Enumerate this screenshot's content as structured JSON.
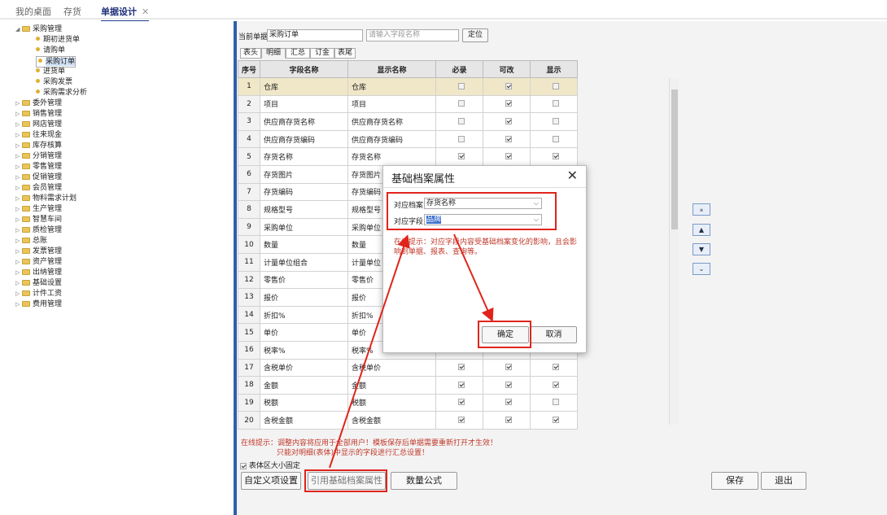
{
  "topbar": {
    "tabs": [
      {
        "label": "我的桌面"
      },
      {
        "label": "存货"
      },
      {
        "label": "单据设计",
        "close": "✕"
      }
    ]
  },
  "tree": {
    "nodes": [
      {
        "label": "采购管理",
        "type": "folder",
        "expanded": true
      },
      {
        "label": "期初进货单",
        "type": "leaf"
      },
      {
        "label": "请购单",
        "type": "leaf"
      },
      {
        "label": "采购订单",
        "type": "leaf",
        "selected": true
      },
      {
        "label": "进货单",
        "type": "leaf"
      },
      {
        "label": "采购发票",
        "type": "leaf"
      },
      {
        "label": "采购需求分析",
        "type": "leaf"
      },
      {
        "label": "委外管理",
        "type": "folder"
      },
      {
        "label": "销售管理",
        "type": "folder"
      },
      {
        "label": "网店管理",
        "type": "folder"
      },
      {
        "label": "往来现金",
        "type": "folder"
      },
      {
        "label": "库存核算",
        "type": "folder"
      },
      {
        "label": "分销管理",
        "type": "folder"
      },
      {
        "label": "零售管理",
        "type": "folder"
      },
      {
        "label": "促销管理",
        "type": "folder"
      },
      {
        "label": "会员管理",
        "type": "folder"
      },
      {
        "label": "物料需求计划",
        "type": "folder"
      },
      {
        "label": "生产管理",
        "type": "folder"
      },
      {
        "label": "智慧车间",
        "type": "folder"
      },
      {
        "label": "质检管理",
        "type": "folder"
      },
      {
        "label": "总账",
        "type": "folder"
      },
      {
        "label": "发票管理",
        "type": "folder"
      },
      {
        "label": "资产管理",
        "type": "folder"
      },
      {
        "label": "出纳管理",
        "type": "folder"
      },
      {
        "label": "基础设置",
        "type": "folder"
      },
      {
        "label": "计件工资",
        "type": "folder"
      },
      {
        "label": "费用管理",
        "type": "folder"
      }
    ]
  },
  "main": {
    "current_doc_label": "当前单据",
    "current_doc_value": "采购订单",
    "field_search_placeholder": "请输入字段名称",
    "locate_button": "定位",
    "subtabs": [
      {
        "label": "表头"
      },
      {
        "label": "明细"
      },
      {
        "label": "汇总"
      },
      {
        "label": "订金"
      },
      {
        "label": "表尾"
      }
    ],
    "columns": [
      "序号",
      "字段名称",
      "显示名称",
      "必录",
      "可改",
      "显示"
    ],
    "rows": [
      {
        "n": "1",
        "field": "仓库",
        "display": "仓库",
        "req": false,
        "edit": true,
        "show": false,
        "highlight": true
      },
      {
        "n": "2",
        "field": "项目",
        "display": "项目",
        "req": false,
        "edit": true,
        "show": false
      },
      {
        "n": "3",
        "field": "供应商存货名称",
        "display": "供应商存货名称",
        "req": false,
        "edit": true,
        "show": false
      },
      {
        "n": "4",
        "field": "供应商存货编码",
        "display": "供应商存货编码",
        "req": false,
        "edit": true,
        "show": false
      },
      {
        "n": "5",
        "field": "存货名称",
        "display": "存货名称",
        "req": true,
        "edit": true,
        "show": true
      },
      {
        "n": "6",
        "field": "存货图片",
        "display": "存货图片",
        "req": false,
        "edit": false,
        "show": false
      },
      {
        "n": "7",
        "field": "存货编码",
        "display": "存货编码",
        "req": false,
        "edit": false,
        "show": false
      },
      {
        "n": "8",
        "field": "规格型号",
        "display": "规格型号",
        "req": false,
        "edit": false,
        "show": false
      },
      {
        "n": "9",
        "field": "采购单位",
        "display": "采购单位",
        "req": false,
        "edit": false,
        "show": false
      },
      {
        "n": "10",
        "field": "数量",
        "display": "数量",
        "req": false,
        "edit": false,
        "show": false
      },
      {
        "n": "11",
        "field": "计量单位组合",
        "display": "计量单位",
        "req": false,
        "edit": false,
        "show": false
      },
      {
        "n": "12",
        "field": "零售价",
        "display": "零售价",
        "req": false,
        "edit": false,
        "show": false
      },
      {
        "n": "13",
        "field": "报价",
        "display": "报价",
        "req": false,
        "edit": false,
        "show": false
      },
      {
        "n": "14",
        "field": "折扣%",
        "display": "折扣%",
        "req": false,
        "edit": false,
        "show": false
      },
      {
        "n": "15",
        "field": "单价",
        "display": "单价",
        "req": false,
        "edit": false,
        "show": false
      },
      {
        "n": "16",
        "field": "税率%",
        "display": "税率%",
        "req": false,
        "edit": false,
        "show": false
      },
      {
        "n": "17",
        "field": "含税单价",
        "display": "含税单价",
        "req": true,
        "edit": true,
        "show": true
      },
      {
        "n": "18",
        "field": "金额",
        "display": "金额",
        "req": true,
        "edit": true,
        "show": true
      },
      {
        "n": "19",
        "field": "税额",
        "display": "税额",
        "req": true,
        "edit": true,
        "show": false
      },
      {
        "n": "20",
        "field": "含税金额",
        "display": "含税金额",
        "req": true,
        "edit": true,
        "show": true
      }
    ],
    "hint1": "在线提示：调整内容将应用于全部用户！模板保存后单据需要重新打开才生效！",
    "hint2": "只能对明细(表体)中显示的字段进行汇总设置！",
    "fixed_size_label": "表体区大小固定",
    "btn_custom": "自定义项设置",
    "btn_ref": "引用基础档案属性",
    "btn_formula": "数量公式",
    "btn_save": "保存",
    "btn_exit": "退出",
    "move_buttons": {
      "top": "⌅",
      "up": "▲",
      "down": "▼",
      "bottom": "⌄"
    }
  },
  "dialog": {
    "title": "基础档案属性",
    "close": "✕",
    "archive_label": "对应档案",
    "archive_value": "存货名称",
    "field_label": "对应字段",
    "field_value": "品牌",
    "hint": "在线提示：对应字段内容受基础档案变化的影响，且会影响到单据、报表、查询等。",
    "ok": "确定",
    "cancel": "取消"
  }
}
